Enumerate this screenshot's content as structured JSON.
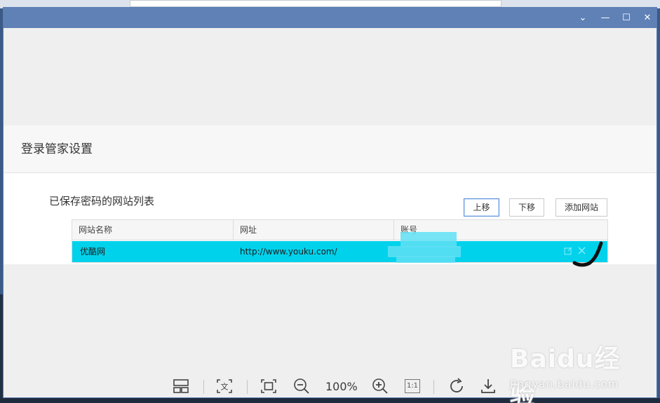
{
  "window": {
    "controls": {
      "collapse": "⌄",
      "minimize": "—",
      "maximize": "☐",
      "close": "✕"
    }
  },
  "dialog": {
    "title": "登录管家设置",
    "list_label": "已保存密码的网站列表",
    "buttons": {
      "move_up": "上移",
      "move_down": "下移",
      "add_site": "添加网站"
    },
    "table": {
      "columns": [
        "网站名称",
        "网址",
        "账号"
      ],
      "rows": [
        {
          "site_name": "优酷网",
          "url": "http://www.youku.com/",
          "account": ""
        }
      ],
      "row_icons": {
        "edit": "edit-icon",
        "delete": "close-icon"
      }
    }
  },
  "viewer_toolbar": {
    "zoom": "100%",
    "actual_size": "1:1",
    "tools": [
      "layout-icon",
      "text-extract-icon",
      "fit-screen-icon",
      "zoom-out-icon",
      "zoom-in-icon",
      "actual-size-icon",
      "rotate-icon",
      "download-icon"
    ]
  },
  "watermark": {
    "main": "Baidu经验",
    "sub": "jingyan.baidu.com"
  },
  "colors": {
    "titlebar": "#5f81b6",
    "selected_row": "#00d2ec",
    "dialog_bg": "#ffffff",
    "viewer_bg": "#efefef"
  }
}
